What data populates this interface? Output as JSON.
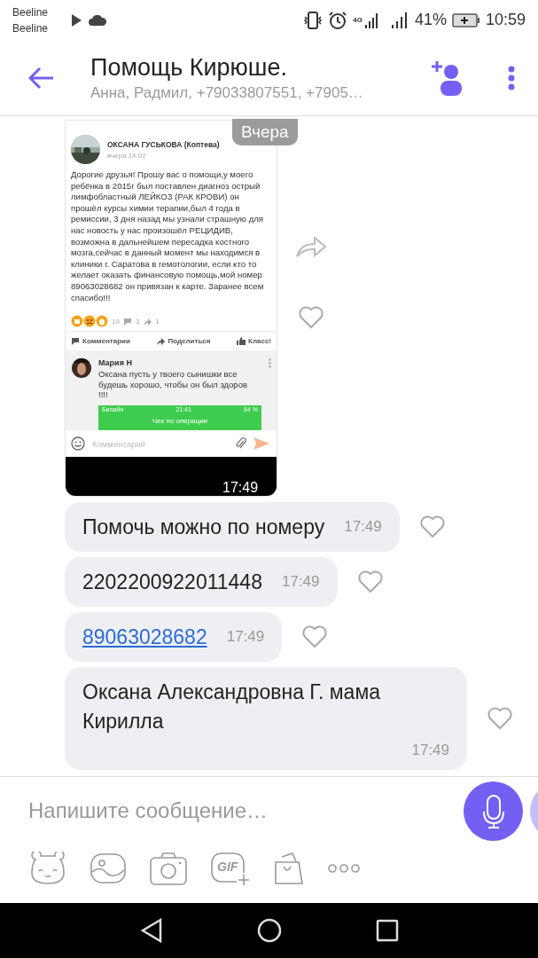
{
  "status_bar": {
    "carriers": [
      "Beeline",
      "Beeline"
    ],
    "network": "4G",
    "battery": "41%",
    "time": "10:59"
  },
  "header": {
    "title": "Помощь Кирюше.",
    "subtitle": "Анна, Радмил, +79033807551, +7905…"
  },
  "chat": {
    "date": "Вчера",
    "messages": [
      {
        "time": "17:49",
        "liked": false,
        "screenshot": {
          "author": "ОКСАНА ГУСЬКОВА (Коптева)",
          "posted": "вчера 14:02",
          "body": "Дорогие друзья! Прошу вас о помощи,у моего ребёнка в  2015г был поставлен диагноз острый лимфобластный ЛЕЙКОЗ (РАК КРОВИ) он прошёл курсы химии терапии,был 4 года в ремиссии, 3 дня назад мы узнали страшную для нас новость у нас произошёл РЕЦИДИВ, возможна в дальнейшем пересадка костного мозга,сейчас в данный момент мы находимся в клиники г. Саратова в гемотологии, если кто то желает оказать финансовую помощь,мой номер 89063028682 он привязан к карте. Заранее всем спасибо!!!",
          "reactions": "19",
          "comments": "3",
          "shares": "1",
          "actions": [
            "Комментарии",
            "Поделиться",
            "Класс!"
          ],
          "comment": {
            "author": "Мария Н",
            "text": "Оксана пусть у твоего сынишки все будешь хорошо, чтобы он был здоров !!!!",
            "receipt": {
              "carrier": "Билайн",
              "time": "21:41",
              "battery": "64 %",
              "title": "Чек по операции"
            }
          },
          "comment_placeholder": "Комментарий"
        }
      },
      {
        "kind": "text",
        "text": "Помочь можно по номеру",
        "time": "17:49",
        "liked": false
      },
      {
        "kind": "text",
        "text": "2202200922011448",
        "time": "17:49",
        "liked": false
      },
      {
        "kind": "link",
        "text": "89063028682",
        "time": "17:49",
        "liked": false
      },
      {
        "kind": "text",
        "text": "Оксана Александровна Г. мама Кирилла",
        "time": "17:49",
        "liked": false
      }
    ]
  },
  "composer": {
    "placeholder": "Напишите сообщение…",
    "gif_label": "GIF"
  }
}
